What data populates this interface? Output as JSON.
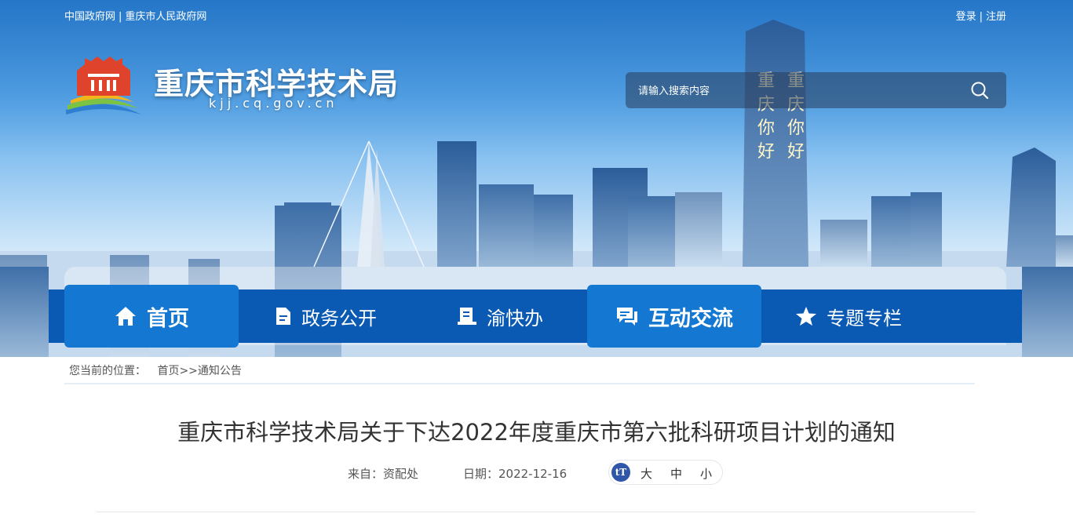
{
  "top_links": {
    "gov_cn": "中国政府网",
    "sep": "|",
    "cq_gov": "重庆市人民政府网"
  },
  "auth": {
    "login": "登录",
    "sep": "|",
    "register": "注册"
  },
  "site": {
    "title": "重庆市科学技术局",
    "domain": "kjj.cq.gov.cn"
  },
  "search": {
    "placeholder": "请输入搜索内容"
  },
  "nav": [
    {
      "label": "首页",
      "icon": "home-icon",
      "active": true
    },
    {
      "label": "政务公开",
      "icon": "document-icon",
      "active": false
    },
    {
      "label": "渝快办",
      "icon": "service-icon",
      "active": false
    },
    {
      "label": "互动交流",
      "icon": "chat-icon",
      "active": true
    },
    {
      "label": "专题专栏",
      "icon": "star-icon",
      "active": false
    }
  ],
  "breadcrumb": {
    "prefix": "您当前的位置：",
    "home": "首页",
    "sep": ">>",
    "current": "通知公告"
  },
  "article": {
    "title": "重庆市科学技术局关于下达2022年度重庆市第六批科研项目计划的通知",
    "source": "来自：资配处",
    "date": "日期：2022-12-16"
  },
  "font_size": {
    "icon_label": "tT",
    "large": "大",
    "medium": "中",
    "small": "小"
  },
  "colors": {
    "nav_bar": "#0a5ab4",
    "nav_active": "#1478d2",
    "font_icon": "#2f56a8"
  }
}
